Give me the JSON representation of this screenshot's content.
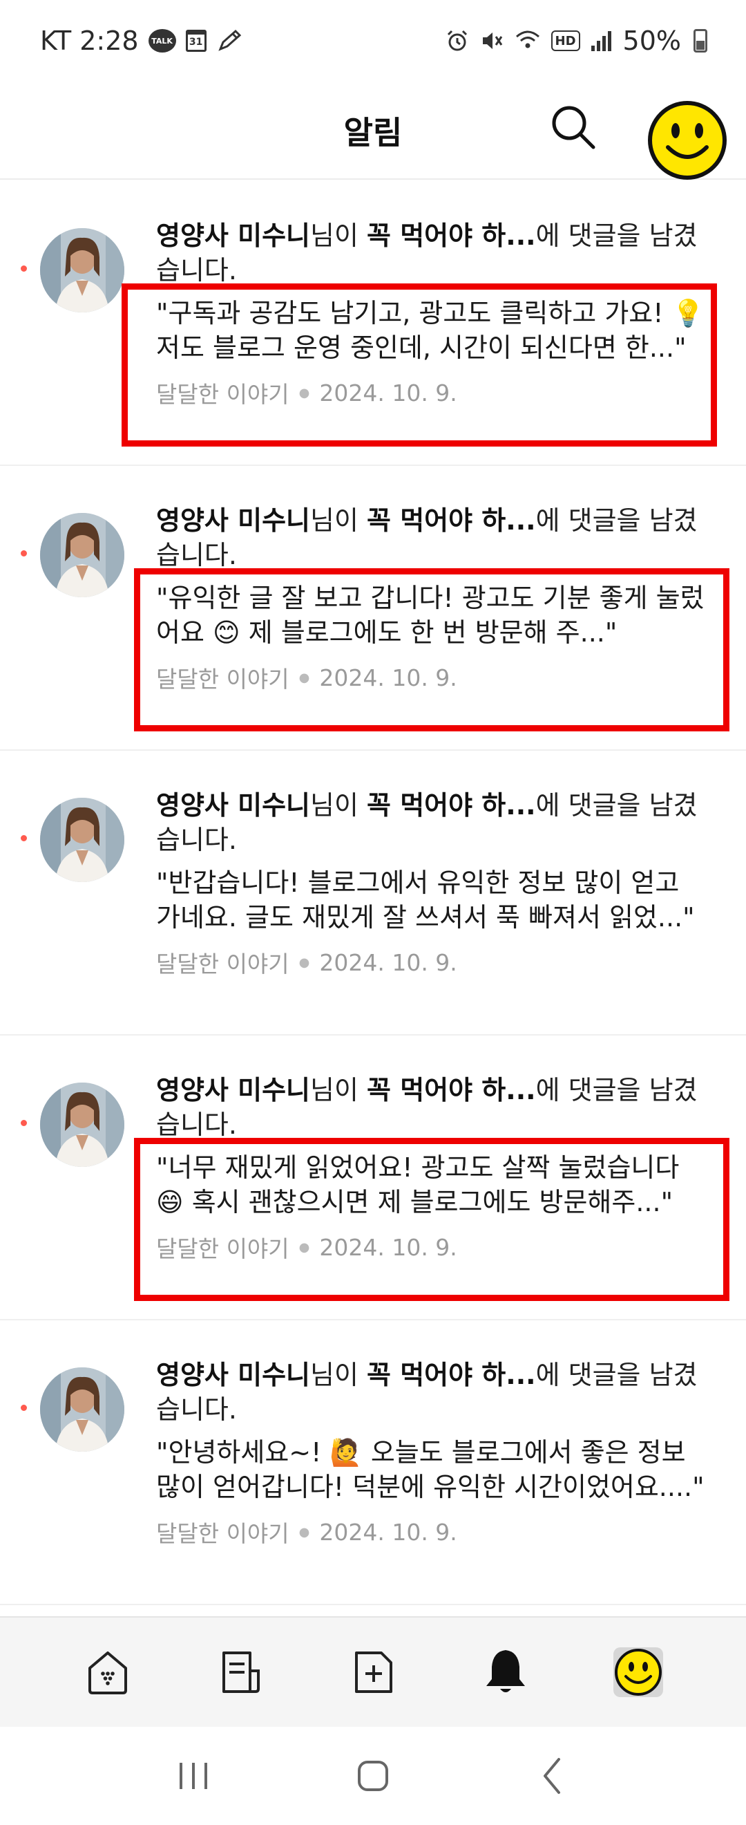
{
  "status_bar": {
    "carrier_time": "KT 2:28",
    "talk_label": "TALK",
    "calendar_day": "31",
    "hd_label": "HD",
    "battery": "50%"
  },
  "header": {
    "title": "알림"
  },
  "notifications": [
    {
      "author": "영양사 미수니",
      "mid1": "님이 ",
      "post": "꼭 먹어야 하...",
      "mid2": "에 댓글을 남겼습니다.",
      "comment": "\"구독과 공감도 남기고, 광고도 클릭하고 가요! 💡 저도 블로그 운영 중인데, 시간이 되신다면 한...\"",
      "blog": "달달한 이야기",
      "date": "2024. 10. 9."
    },
    {
      "author": "영양사 미수니",
      "mid1": "님이 ",
      "post": "꼭 먹어야 하...",
      "mid2": "에 댓글을 남겼습니다.",
      "comment": "\"유익한 글 잘 보고 갑니다! 광고도 기분 좋게 눌렀어요 😊 제 블로그에도 한 번 방문해 주...\"",
      "blog": "달달한 이야기",
      "date": "2024. 10. 9."
    },
    {
      "author": "영양사 미수니",
      "mid1": "님이 ",
      "post": "꼭 먹어야 하...",
      "mid2": "에 댓글을 남겼습니다.",
      "comment": "\"반갑습니다! 블로그에서 유익한 정보 많이 얻고 가네요. 글도 재밌게 잘 쓰셔서 푹 빠져서 읽었...\"",
      "blog": "달달한 이야기",
      "date": "2024. 10. 9."
    },
    {
      "author": "영양사 미수니",
      "mid1": "님이 ",
      "post": "꼭 먹어야 하...",
      "mid2": "에 댓글을 남겼습니다.",
      "comment": "\"너무 재밌게 읽었어요! 광고도 살짝 눌렀습니다 😄 혹시 괜찮으시면 제 블로그에도 방문해주...\"",
      "blog": "달달한 이야기",
      "date": "2024. 10. 9."
    },
    {
      "author": "영양사 미수니",
      "mid1": "님이 ",
      "post": "꼭 먹어야 하...",
      "mid2": "에 댓글을 남겼습니다.",
      "comment": "\"안녕하세요~! 🙋 오늘도 블로그에서 좋은 정보 많이 얻어갑니다! 덕분에 유익한 시간이었어요....\"",
      "blog": "달달한 이야기",
      "date": "2024. 10. 9."
    }
  ],
  "bottom_nav": {
    "items": [
      "home-icon",
      "feed-icon",
      "write-icon",
      "bell-icon",
      "profile-smiley-icon"
    ],
    "active": "bell-icon"
  },
  "colors": {
    "highlight": "#ee0000",
    "unread_dot": "#ff5a4e",
    "smiley": "#ffe600"
  }
}
